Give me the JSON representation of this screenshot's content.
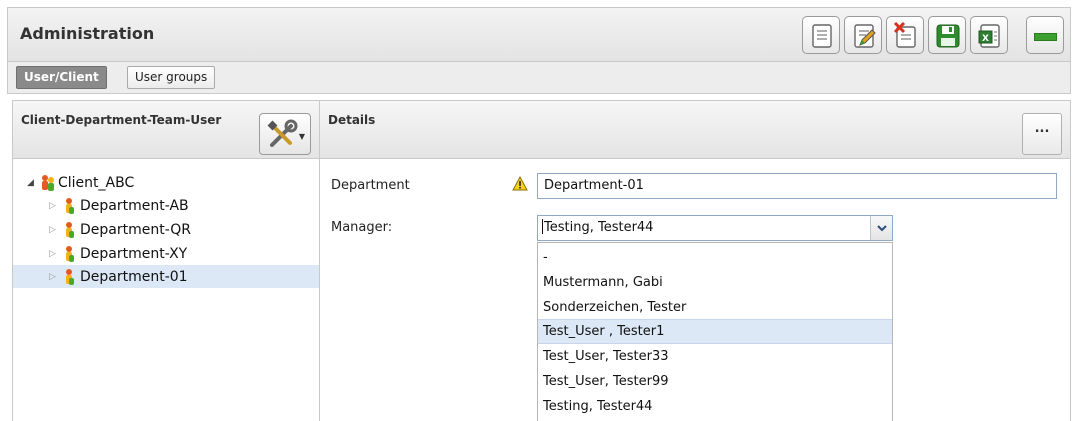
{
  "header": {
    "title": "Administration"
  },
  "toolbar": {
    "buttons": [
      {
        "icon": "new-document-icon"
      },
      {
        "icon": "edit-document-icon"
      },
      {
        "icon": "delete-document-icon"
      },
      {
        "icon": "save-icon"
      },
      {
        "icon": "excel-export-icon"
      }
    ],
    "minimize_icon": "minimize-icon"
  },
  "tabs": [
    {
      "label": "User/Client",
      "active": true
    },
    {
      "label": "User groups",
      "active": false
    }
  ],
  "left_panel": {
    "title": "Client-Department-Team-User",
    "tools_icon": "tools-icon",
    "tree": {
      "root": {
        "label": "Client_ABC",
        "expanded": true
      },
      "children": [
        {
          "label": "Department-AB"
        },
        {
          "label": "Department-QR"
        },
        {
          "label": "Department-XY"
        },
        {
          "label": "Department-01",
          "selected": true
        }
      ]
    }
  },
  "details": {
    "title": "Details",
    "more_label": "...",
    "department_label": "Department",
    "department_value": "Department-01",
    "manager_label": "Manager:",
    "manager_value": "Testing, Tester44",
    "manager_options": [
      "-",
      "Mustermann, Gabi",
      "Sonderzeichen, Tester",
      "Test_User , Tester1",
      "Test_User, Tester33",
      "Test_User, Tester99",
      "Testing, Tester44"
    ],
    "highlighted_option": "Test_User , Tester1"
  },
  "colors": {
    "selection": "#dde8f6",
    "input_border": "#8fa8c8",
    "save_green": "#2e8b2e",
    "delete_red": "#d9301f"
  }
}
